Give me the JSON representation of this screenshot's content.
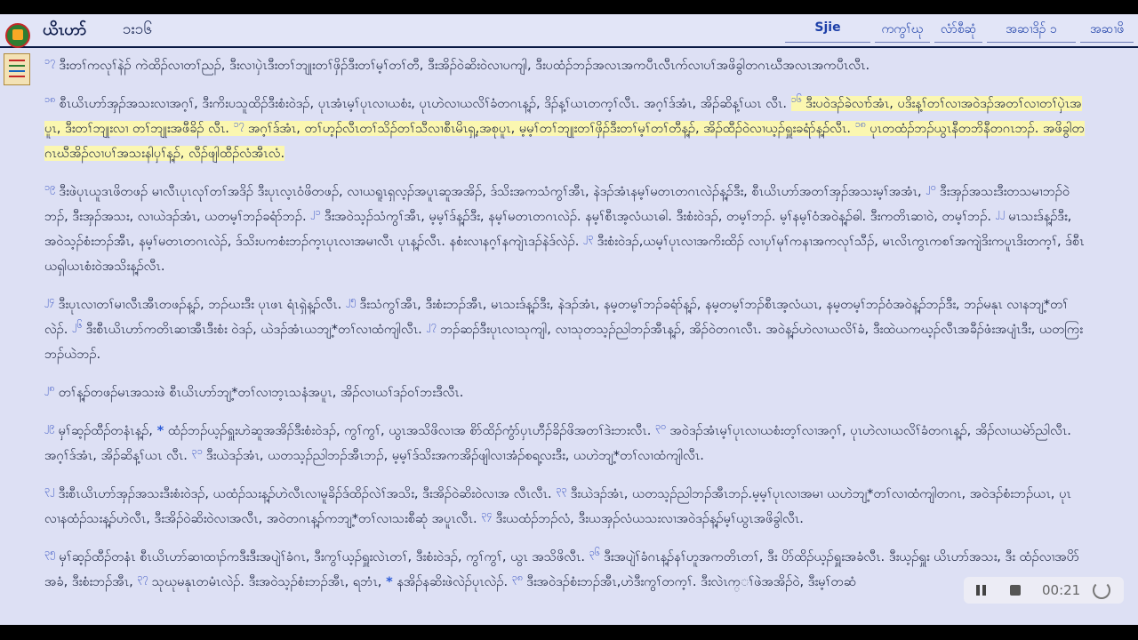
{
  "header": {
    "book": "ယိၤဟာ်",
    "chapter_ref": "၁း၁၆",
    "menu": [
      {
        "label": "Sjie"
      },
      {
        "label": "ကကွၢ်ဃု"
      },
      {
        "label": "လံာ်စီဆုံ"
      },
      {
        "label": "အဆၢဒိၣ် ၁"
      },
      {
        "label": "အဆၢဖိ"
      }
    ]
  },
  "content": {
    "p1": {
      "v17": "၁၇",
      "t17": "ဒီးတၢ်ကလုၢ်နဲၣ် ကဲထိၣ်လၢတၢ်ညၣ်, ဒီးလၢပှဲၤဒီးတၢ်ဘျုးတၢ်ဖှိၣ်ဒီးတၢ်မ့ၢ်တၢ်တီ, ဒီးအိၣ်ဝဲဆိးဝဲလၢပကျါ, ဒီးပထံၣ်ဘၣ်အလၤအကပီၤလီၤက်လၢပၢ်အဖိခွါတဂၤဃီအလၤအကပီၤလီၤ."
    },
    "p2": {
      "v18": "၁၈",
      "t18": "စီၤယိၤဟာ်အှၣ်အသးလၢအဂ့ၢ်, ဒီးကိးပသူထိၣ်ဒီးစံးဝဲဒၣ်, ပုၤအံၤမ့ၢ်ပုၤလၢယစံး, ပုၤဟဲလၢယလိၢ်ခံတဂၤန့ၣ်, ဒိၣ်န့ၢ်ယၤတက့ၢ်လီၤ. အဂ့ၢ်ဒ်အံၤ, အိၣ်ဆိန့ၢ်ယၤ လီၤ.",
      "v19": "၁၆",
      "t19": "ဒီးပဝဲဒၣ်ခဲလၢာ်အံၤ, ပဒိးန့ၢ်တၢ်လၢအဝဲဒၣ်အတၢ်လၢတၢ်ပှဲၤအပူၤ, ဒီးတၢ်ဘျုးလၢ တၢ်ဘျုးအဖီခိၣ် လီၤ.",
      "v20": "၁၇",
      "t20": "အဂ့ၢ်ဒ်အံၤ, တၢ်ဟ့ၣ်လီၤတၢ်သိၣ်တၢ်သီလၢစီၤမိၤရှ့,အစုပူၤ, မ့မ့ၢ်တၢ်ဘျုးတၢ်ဖှိၣ်ဒီးတၢ်မ့ၢ်တၢ်တီန့ၣ်, အိၣ်ထီၣ်ဝဲလၢယ့ၣ်ရှူးခရံာ်န့ၣ်လီၤ.",
      "v21": "၁၈",
      "t21": "ပုၤတထံၣ်ဘၣ်ယွၤနီတဘိနီတဂၤဘၣ်. အဖိခွါတဂၤဃီအိၣ်လၢပၢ်အသးနါပှၢ်န့ၣ်, လီၣ်ဖျါထီၣ်လံအီၤလံ."
    },
    "p3": {
      "v19": "၁၉",
      "t19": "ဒီးဖဲပုၤယူဒၤဖိတဖၣ် မၢလီၤပုၤလုၢ်တၢ်အဒိၣ် ဒီးပုၤလ့ၤဝံဖိတဖၣ်, လၢယရူၤရှလ့ၣ်အပူၤဆူအအိၣ်, ဒ်သိးအကသံကွၢ်အီၤ, နဲဒၣ်အံၤနမ့ၢ်မတၤတဂၤလဲၣ်န့ၣ်ဒီး, စီၤယိၤဟာ်အတၢ်အှၣ်အသးမ့ၢ်အအံၤ,",
      "v20": "၂၀",
      "t20": "ဒီးအှၣ်အသးဒီးတသမၢဘၣ်ဝဲဘၣ်, ဒီးအှၣ်အသး, လၢယဲဒၣ်အံၤ, ယတမ့ၢ်ဘၣ်ခရံာ်ဘၣ်.",
      "v21": "၂၁",
      "t21": "ဒီးအဝဲသ့ၣ်သံကွၢ်အီၤ, မ့မ့ၢ်ဒ်န့ၣ်ဒီး, နမ့ၢ်မတၤတဂၤလဲၣ်. နမ့ၢ်စီၤအ့လံယၤဓါ. ဒီးစံးဝဲဒၣ်, တမ့ၢ်ဘၣ်. မ့ၢ်နမ့ၢ်ဝံအဝဲန့ၣ်ဓါ. ဒီးကတိၤဆၢဝဲ, တမ့ၢ်ဘၣ်.",
      "v22": "၂၂",
      "t22": "မၤသးဒ်န့ၣ်ဒီး, အဝဲသ့ၣ်စံးဘၣ်အီၤ, နမ့ၢ်မတၤတဂၤလဲၣ်, ဒ်သိးပကစံးဘၣ်က့ၤပုၤလၢအမၢလီၤ ပုၤန့ၣ်လီၤ. နစံးလၢနဂ့ၢ်နကျဲၤဒၣ်နဲဒ်လဲၣ်.",
      "v23": "၂၃",
      "t23": "ဒီးစံးဝဲဒၣ်,ယမ့ၢ်ပုၤလၢအကိးထိၣ် လၢပှၢ်မုၢ်ကနၢအကလုၢ်သီၣ်, မၤလိၤကွၤကစၢ်အကျဲဒိးကပူၤဒိးတက့ၢ်, ဒ်စီၤယရှါယၤစံးဝဲအသိးန့ၣ်လီၤ."
    },
    "p4": {
      "v24": "၂၄",
      "t24": "ဒီးပုၤလၢတၢ်မၢလီၤအီၤတဖၣ်န့ၣ်, ဘၣ်ဃးဒီး ပုၤဖၤ ရံၤရှဲန့ၣ်လီၤ.",
      "v25": "၂၅",
      "t25": "ဒီးသံကွၢ်အီၤ, ဒီးစံးဘၣ်အီၤ, မၤသးဒ်န့ၣ်ဒီး, နဲဒၣ်အံၤ, နမ့တမ့ၢ်ဘၣ်ခရံာ်န့ၣ်, နမ့တမ့ၢ်ဘၣ်စီၤအ့လံယၤ, နမ့တမ့ၢ်ဘၣ်ဝံအဝဲန့ၣ်ဘၣ်ဒီး, ဘၣ်မနုၤ လၢနဘျ့*တၢ်လဲၣ်.",
      "v26": "၂၆",
      "t26": "ဒီးစီၤယိၤဟာ်ကတိၤဆၢအီၤဒီးစံး ဝဲဒၣ်, ယဲဒၣ်အံၤယဘျ့*တၢ်လၢထံကျါလီၤ.",
      "v27": "၂၇",
      "t27": "ဘၣ်ဆၣ်ဒီးပုၤလၢသုကျါ, လၢသုတသ့ၣ်ညါဘၣ်အီၤန့ၣ်, အိၣ်ဝဲတဂၤလီၤ. အဝဲန့ၣ်ဟဲလၢယလိၢ်ခံ, ဒီးထဲယကဃ့ၣ်လီၤအခီၣ်ဖံးအပျံၤဒီး, ယတကြးဘၣ်ယဲဘၣ်."
    },
    "p5": {
      "v28": "၂၈",
      "t28": "တၢ်န့ၣ်တဖၣ်မၤအသးဖဲ စီၤယိၤဟာ်ဘျ့*တၢ်လၢဘ့ၤသနံအပူၤ, အိၣ်လၢယၢ်ဒၣ်ဝၢ်ဘးဒီလီၤ."
    },
    "p6": {
      "v29": "၂၉",
      "t29a": "မှၢ်ဆ့ၣ်ထီၣ်တနံၤန့ၣ်,",
      "ft": "*",
      "t29b": "ထံၣ်ဘၣ်ယ့ၣ်ရှူးဟဲဆူအအိၣ်ဒီးစံးဝဲဒၣ်, ကွၢ်ကွၢ်, ယွၤအသိဖိလၢအ စိာ်ထိၣ်ကွံာ်ပှၤဟီၣ်ခိၣ်ဖိအတၢ်ဒဲးဘးလီၤ.",
      "v30": "၃၀",
      "t30": "အဝဲဒၣ်အံၤမ့ၢ်ပုၤလၢယစံးတ့ၢ်လၢအဂ့ၢ်, ပုၤဟဲလၢယလိၢ်ခံတဂၤန့ၣ်, အိၣ်လၢယမဲာ်ညါလီၤ. အဂ့ၢ်ဒ်အံၤ, အိၣ်ဆိန့ၢ်ယၤ လီၤ.",
      "v31": "၃၁",
      "t31": "ဒီးယဲဒၣ်အံၤ, ယတသ့ၣ်ညါဘၣ်အီၤဘၣ်, မ့မ့ၢ်ဒ်သိးအကအိၣ်ဖျါလၢအံၣ်စရ့လးဒီး, ယဟဲဘျ့*တၢ်လၢထံကျါလီၤ."
    },
    "p7": {
      "v32": "၃၂",
      "t32": "ဒီးစီၤယိၤဟာ်အှၣ်အသးဒီးစံးဝဲဒၣ်, ယထံၣ်သးန့ၣ်ဟဲလီၤလၢမူခိၣ်ဒ်ထိၣ်လဲၢ်အသိး, ဒီးအိၣ်ဝဲဆိးဝဲလၢအ လီၤလီၤ.",
      "v33": "၃၃",
      "t33": "ဒီးယဲဒၣ်အံၤ, ယတသ့ၣ်ညါဘၣ်အီၤဘၣ်.မ့မ့ၢ်ပုၤလၢအမၢ ယဟဲဘျ့*တၢ်လၢထံကျါတဂၤ, အဝဲဒၣ်စံးဘၣ်ယၤ, ပုၤလၢနထံၣ်သးန့ၣ်ဟဲလီၤ, ဒီးအိၣ်ဝဲဆိးဝဲလၢအလီၤ, အဝဲတဂၤန့ၣ်ကဘျ့*တၢ်လၢသးစီဆုံ အပူၤလီၤ.",
      "v34": "၃၄",
      "t34": "ဒီးယထံၣ်ဘၣ်လံ, ဒီးယအှၣ်လံယသးလၢအဝဲဒၣ်န့ၣ်မ့ၢ်ယွၤအဖိခွါလီၤ."
    },
    "p8": {
      "v35": "၃၅",
      "t35": "မှၢ်ဆ့ၣ်ထီၣ်တနံၤ စီၤယိၤဟာ်ဆၢထၢၣ်ကဒီးဒီးအပျဲၢ်ခံဂၤ, ဒီးကွၢ်ယ့ၣ်ရှူးလဲၤတၢ်, ဒီးစံးဝဲဒၣ်, ကွၢ်ကွၢ်, ယွၤ အသိဖိလီၤ.",
      "v36": "၃၆",
      "t36a": "ဒီးအပျဲၢ်ခံဂၤန့ၣ်နၢ်ဟူအကတိၤတၢ်, ဒီး ပိာ်ထိၣ်ယ့ၣ်ရှူးအခံလီၤ. ဒီးယ့ၣ်ရှူး",
      "t36b": "ယိၤဟာ်အသး, ဒီး ထံၣ်လၢအပိာ်အခံ, ဒီးစံးဘၣ်အီၤ,",
      "v37": "၃၇",
      "t37a": "သုဃုမနုၤတမံၤလဲၣ်. ဒီးအဝဲသ့ၣ်စံးဘၣ်အီၤ, ရဘံၤ,",
      "ft2": "*",
      "t37b": "နအိၣ်နဆိးဖဲလဲၣ်ပုၤလဲၣ်.",
      "v38": "၃၈",
      "t38": "ဒီးအဝဲဒၣ်စံးဘၣ်အီၤ,ဟဲဒီးကွၢ်တက့ၢ်. ဒီးလဲၤက္ၢ်ဖဲအအိၣ်ဝဲ, ဒီးမ့ၢ်တဆံ"
    }
  },
  "player": {
    "time": "00:21"
  }
}
